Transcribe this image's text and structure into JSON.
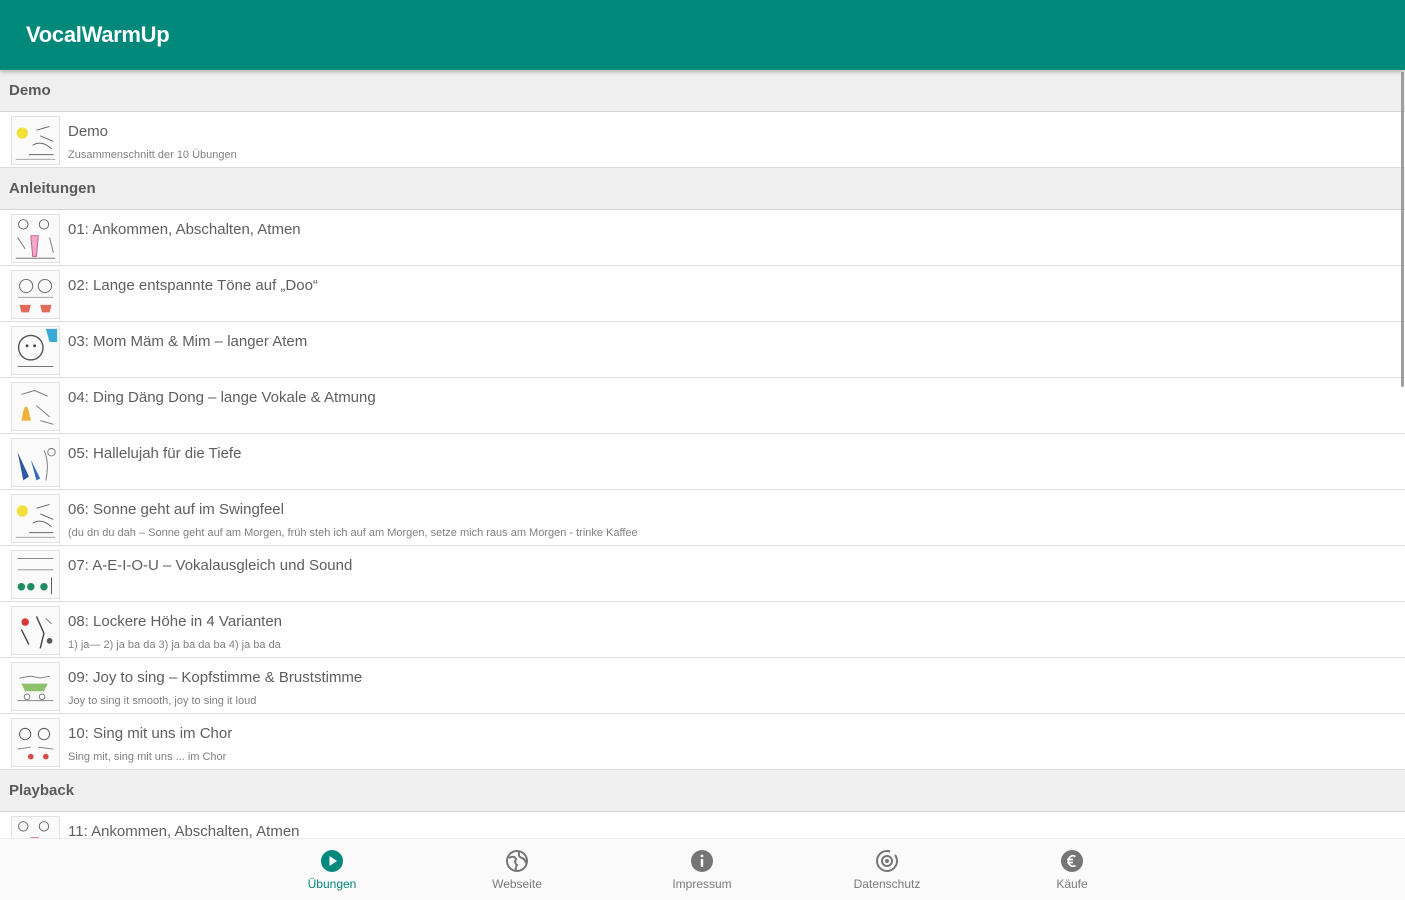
{
  "app": {
    "title": "VocalWarmUp"
  },
  "colors": {
    "primary": "#00897b",
    "section_bg": "#efefef",
    "nav_inactive": "#757575"
  },
  "sections": [
    {
      "label": "Demo"
    },
    {
      "label": "Anleitungen"
    },
    {
      "label": "Playback"
    }
  ],
  "items": [
    {
      "title": "Demo",
      "subtitle": "Zusammenschnitt der 10 Übungen",
      "thumb_icon": "sun-drawing-icon"
    },
    {
      "title": "01: Ankommen, Abschalten, Atmen",
      "subtitle": "",
      "thumb_icon": "children-drawing-icon"
    },
    {
      "title": "02: Lange entspannte Töne auf „Doo“",
      "subtitle": "",
      "thumb_icon": "faces-drawing-icon"
    },
    {
      "title": "03: Mom Mäm & Mim – langer Atem",
      "subtitle": "",
      "thumb_icon": "singer-drawing-icon"
    },
    {
      "title": "04: Ding Däng Dong – lange Vokale & Atmung",
      "subtitle": "",
      "thumb_icon": "bell-drawing-icon"
    },
    {
      "title": "05: Hallelujah für die Tiefe",
      "subtitle": "",
      "thumb_icon": "figures-drawing-icon"
    },
    {
      "title": "06: Sonne geht auf im Swingfeel",
      "subtitle": "(du dn du dah – Sonne geht auf am Morgen, früh steh ich auf am Morgen, setze mich raus am Morgen - trinke Kaffee",
      "thumb_icon": "sun-drawing-icon"
    },
    {
      "title": "07: A-E-I-O-U – Vokalausgleich und Sound",
      "subtitle": "",
      "thumb_icon": "vowels-drawing-icon"
    },
    {
      "title": "08: Lockere Höhe in 4 Varianten",
      "subtitle": "1) ja— 2) ja ba da 3) ja ba da ba 4) ja ba da",
      "thumb_icon": "dancers-drawing-icon"
    },
    {
      "title": "09: Joy to sing – Kopfstimme & Bruststimme",
      "subtitle": "Joy to sing it smooth, joy to sing it loud",
      "thumb_icon": "group-drawing-icon"
    },
    {
      "title": "10: Sing mit uns im Chor",
      "subtitle": "Sing mit, sing mit uns ... im Chor",
      "thumb_icon": "choir-drawing-icon"
    },
    {
      "title": "11: Ankommen, Abschalten, Atmen",
      "subtitle": "",
      "thumb_icon": "children-drawing-icon"
    }
  ],
  "nav": [
    {
      "label": "Übungen",
      "icon": "play-circle-icon",
      "active": true
    },
    {
      "label": "Webseite",
      "icon": "globe-icon",
      "active": false
    },
    {
      "label": "Impressum",
      "icon": "info-icon",
      "active": false
    },
    {
      "label": "Datenschutz",
      "icon": "privacy-icon",
      "active": false
    },
    {
      "label": "Käufe",
      "icon": "euro-icon",
      "active": false
    }
  ]
}
